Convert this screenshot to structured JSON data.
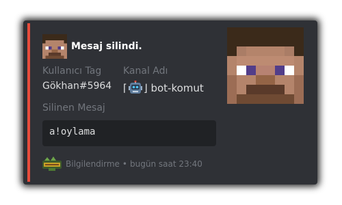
{
  "embed": {
    "accent_color": "#e74c3c",
    "author": {
      "icon": "steve-face-icon",
      "name": "Mesaj silindi."
    },
    "fields": [
      {
        "name": "Kullanıcı Tag",
        "value": "Gökhan#5964"
      },
      {
        "name": "Kanal Adı",
        "value_prefix": "⌈",
        "icon": "robot-icon",
        "value_suffix": "⌋ bot-komut"
      }
    ],
    "deleted_message": {
      "name": "Silinen Mesaj",
      "code": "a!oylama"
    },
    "thumbnail": "steve-face-thumbnail",
    "footer": {
      "icon": "server-logo-icon",
      "text": "Bilgilendirme",
      "separator": "•",
      "timestamp": "bugün saat 23:40"
    }
  }
}
